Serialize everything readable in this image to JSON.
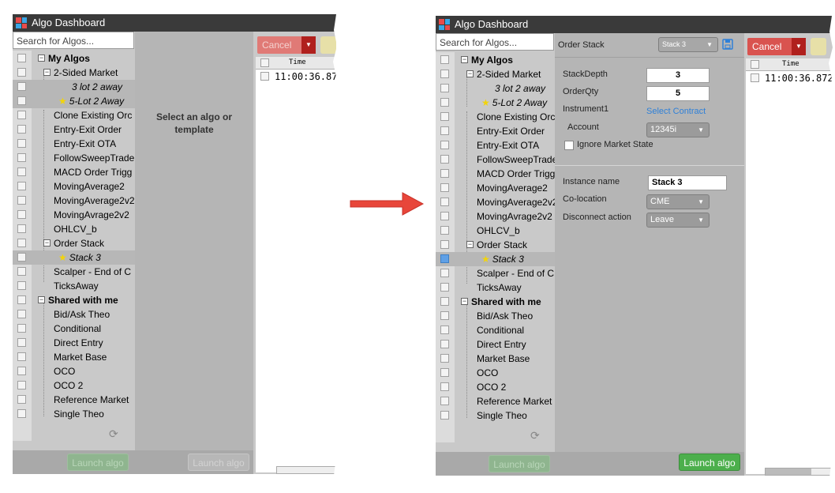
{
  "app_title": "Algo Dashboard",
  "search_placeholder": "Search for Algos...",
  "before": {
    "message": "Select an algo or template",
    "launch_label": "Launch algo",
    "launch_label_2": "Launch algo",
    "cancel_label": "Cancel",
    "grid_header": "Time",
    "grid_time": "11:00:36.87"
  },
  "after": {
    "cancel_label": "Cancel",
    "grid_header": "Time",
    "grid_time": "11:00:36.872",
    "launch_label_disabled": "Launch algo",
    "launch_label": "Launch algo",
    "order_stack_label": "Order Stack",
    "stack_select": "Stack 3",
    "params": {
      "stack_depth_label": "StackDepth",
      "stack_depth_value": "3",
      "order_qty_label": "OrderQty",
      "order_qty_value": "5",
      "instrument_label": "Instrument1",
      "instrument_link": "Select Contract",
      "account_label": "Account",
      "account_value": "12345i",
      "ignore_label": "Ignore Market State"
    },
    "instance": {
      "name_label": "Instance name",
      "name_value": "Stack 3",
      "coloc_label": "Co-location",
      "coloc_value": "CME",
      "disconnect_label": "Disconnect action",
      "disconnect_value": "Leave"
    }
  },
  "tree": {
    "my_algos": "My Algos",
    "two_sided": "2-Sided Market",
    "lot3": "3 lot 2 away",
    "lot5": "5-Lot 2 Away",
    "clone": "Clone Existing Orc",
    "entry_exit": "Entry-Exit Order",
    "entry_exit_ota": "Entry-Exit OTA",
    "follow": "FollowSweepTrade",
    "macd": "MACD Order Trigg",
    "ma2": "MovingAverage2",
    "ma2v2": "MovingAverage2v2",
    "mavrage": "MovingAvrage2v2",
    "ohlcv": "OHLCV_b",
    "order_stack": "Order Stack",
    "stack3": "Stack 3",
    "scalper": "Scalper - End of C",
    "ticks": "TicksAway",
    "shared": "Shared with me",
    "bidask": "Bid/Ask Theo",
    "conditional": "Conditional",
    "direct": "Direct Entry",
    "market_base": "Market Base",
    "oco": "OCO",
    "oco2": "OCO 2",
    "reference": "Reference Market",
    "single": "Single Theo"
  },
  "colors": {
    "arrow": "#e8463a",
    "launch": "#4caf4c",
    "cancel": "#d9534f"
  }
}
